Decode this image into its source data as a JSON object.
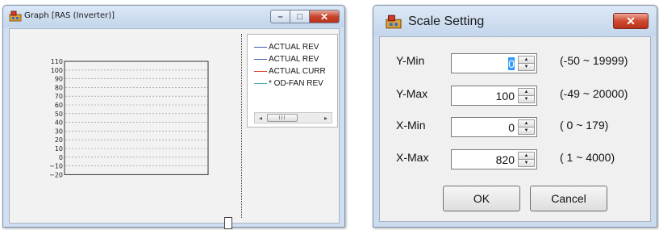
{
  "graph_window": {
    "title": "Graph [RAS (Inverter)]",
    "caption": {
      "minimize": "–",
      "maximize": "□",
      "close": "✕"
    },
    "y_ticks": [
      "110",
      "100",
      "90",
      "80",
      "70",
      "60",
      "50",
      "40",
      "30",
      "20",
      "10",
      "0",
      "−10",
      "−20"
    ],
    "legend": [
      {
        "label": "ACTUAL REV",
        "color": "#3a5dab"
      },
      {
        "label": "ACTUAL REV",
        "color": "#3a5dab"
      },
      {
        "label": "ACTUAL CURR",
        "color": "#d9402a"
      },
      {
        "label": "* OD-FAN REV",
        "color": "#4fa7b0"
      }
    ],
    "scrollbar": {
      "left": "◂",
      "right": "▸",
      "grip": "III"
    }
  },
  "scale_dialog": {
    "title": "Scale Setting",
    "close": "✕",
    "fields": [
      {
        "label": "Y-Min",
        "value": "0",
        "range": "(-50 ~ 19999)",
        "selected": true
      },
      {
        "label": "Y-Max",
        "value": "100",
        "range": "(-49 ~ 20000)",
        "selected": false
      },
      {
        "label": "X-Min",
        "value": "0",
        "range": "( 0 ~ 179)",
        "selected": false
      },
      {
        "label": "X-Max",
        "value": "820",
        "range": "( 1 ~ 4000)",
        "selected": false
      }
    ],
    "ok_label": "OK",
    "cancel_label": "Cancel",
    "spin_up": "▲",
    "spin_down": "▼"
  }
}
